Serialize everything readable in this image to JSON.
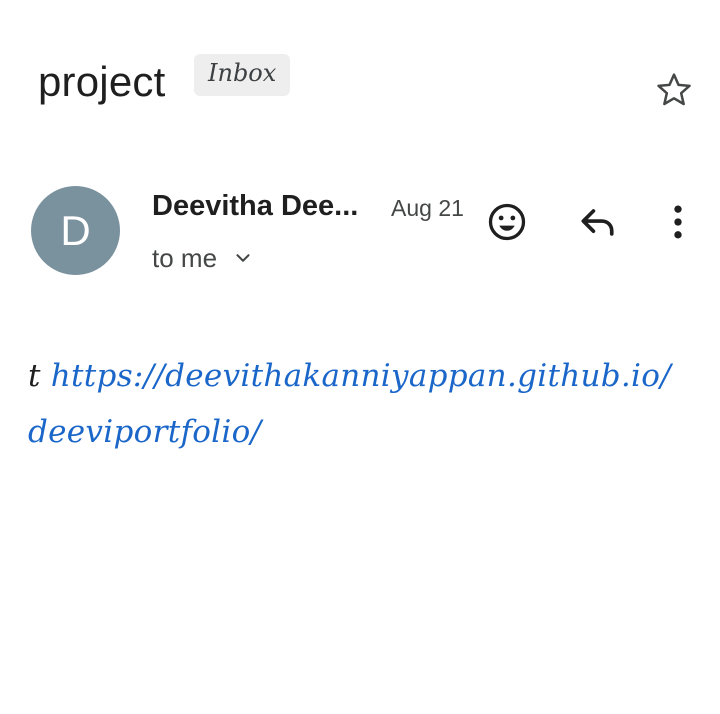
{
  "email": {
    "subject": "project",
    "label": "Inbox",
    "sender": {
      "avatar_letter": "D",
      "avatar_color": "#7a919e",
      "name": "Deevitha Dee...",
      "date": "Aug 21",
      "recipients": "to me"
    },
    "body": {
      "leading_text": "t",
      "link_text": "https://deevithakanniyappan.github.io/deeviportfolio/",
      "link_color": "#1a66c9"
    }
  },
  "icons": {
    "star": "star-outline-icon",
    "expand": "chevron-down-icon",
    "reaction": "emoji-smile-icon",
    "reply": "reply-icon",
    "more": "more-vertical-icon"
  }
}
